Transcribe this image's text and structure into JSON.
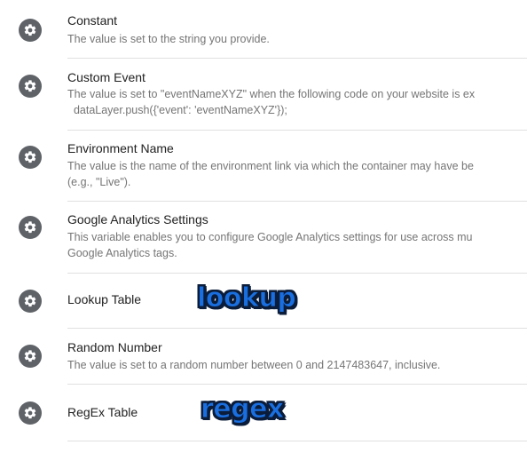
{
  "colors": {
    "icon_bg": "#5f6368",
    "title": "#212121",
    "description": "#757575",
    "divider": "#e0e0e0",
    "annotation": "#1a6fe0"
  },
  "variables": [
    {
      "icon": "gear-icon",
      "title": "Constant",
      "description": "The value is set to the string you provide.",
      "description_2": ""
    },
    {
      "icon": "gear-icon",
      "title": "Custom Event",
      "description": "The value is set to \"eventNameXYZ\" when the following code on your website is ex",
      "description_2": "  dataLayer.push({'event': 'eventNameXYZ'});"
    },
    {
      "icon": "gear-icon",
      "title": "Environment Name",
      "description": "The value is the name of the environment link via which the container may have be",
      "description_2": "(e.g., \"Live\")."
    },
    {
      "icon": "gear-icon",
      "title": "Google Analytics Settings",
      "description": "This variable enables you to configure Google Analytics settings for use across mu",
      "description_2": "Google Analytics tags."
    },
    {
      "icon": "gear-icon",
      "title": "Lookup Table",
      "description": "",
      "description_2": ""
    },
    {
      "icon": "gear-icon",
      "title": "Random Number",
      "description": "The value is set to a random number between 0 and 2147483647, inclusive.",
      "description_2": ""
    },
    {
      "icon": "gear-icon",
      "title": "RegEx Table",
      "description": "",
      "description_2": ""
    }
  ],
  "annotations": {
    "lookup": "lookup",
    "regex": "regex"
  }
}
